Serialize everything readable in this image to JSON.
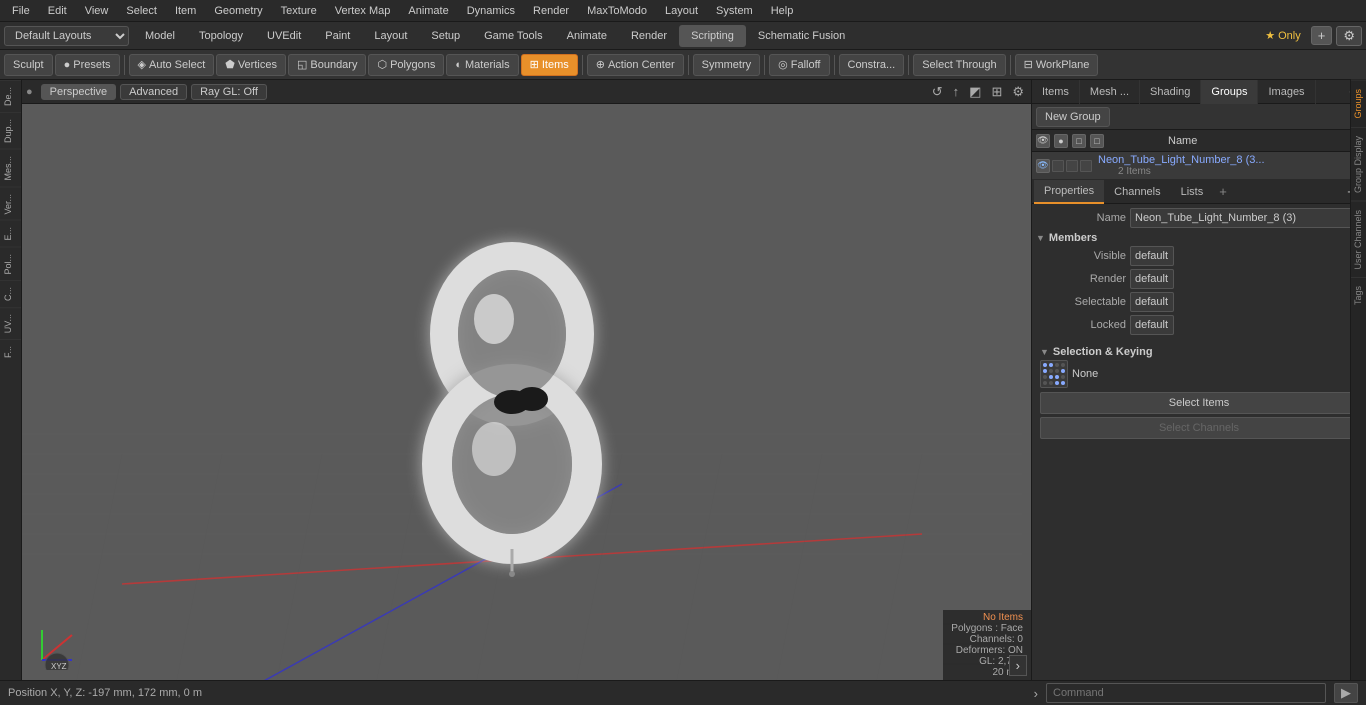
{
  "menubar": {
    "items": [
      "File",
      "Edit",
      "View",
      "Select",
      "Item",
      "Geometry",
      "Texture",
      "Vertex Map",
      "Animate",
      "Dynamics",
      "Render",
      "MaxToModo",
      "Layout",
      "System",
      "Help"
    ]
  },
  "layout_bar": {
    "selector": "Default Layouts",
    "tabs": [
      "Model",
      "Topology",
      "UVEdit",
      "Paint",
      "Layout",
      "Setup",
      "Game Tools",
      "Animate",
      "Render",
      "Scripting",
      "Schematic Fusion"
    ],
    "add_btn": "+",
    "star_only": "★ Only",
    "gear_btn": "⚙"
  },
  "toolbar": {
    "sculpt": "Sculpt",
    "presets": "Presets",
    "auto_select": "Auto Select",
    "vertices": "Vertices",
    "boundary": "Boundary",
    "polygons": "Polygons",
    "materials": "Materials",
    "items": "Items",
    "action_center": "Action Center",
    "symmetry": "Symmetry",
    "falloff": "Falloff",
    "constraints": "Constra...",
    "select_through": "Select Through",
    "workplane": "WorkPlane"
  },
  "viewport": {
    "tabs": [
      "Perspective",
      "Advanced",
      "Ray GL: Off"
    ],
    "header_icons": [
      "↺",
      "↑",
      "◩",
      "⊞",
      "⚙"
    ]
  },
  "left_sidebar": {
    "tabs": [
      "De...",
      "Dup...",
      "Mes...",
      "Ver...",
      "E...",
      "Pol...",
      "C...",
      "UV...",
      "F..."
    ]
  },
  "right_panel": {
    "top_tabs": [
      "Items",
      "Mesh ...",
      "Shading",
      "Groups",
      "Images"
    ],
    "groups_toolbar": {
      "new_group": "New Group"
    },
    "list_header": {
      "name_col": "Name"
    },
    "group_item": {
      "name": "Neon_Tube_Light_Number_8 (3...",
      "full_name": "Neon_Tube_Light_Number_8 (3)",
      "count": "2 Items"
    }
  },
  "properties": {
    "tabs": [
      "Properties",
      "Channels",
      "Lists"
    ],
    "add_tab": "+",
    "name_label": "Name",
    "name_value": "Neon_Tube_Light_Number_8 (3)",
    "members_section": "Members",
    "fields": [
      {
        "label": "Visible",
        "value": "default"
      },
      {
        "label": "Render",
        "value": "default"
      },
      {
        "label": "Selectable",
        "value": "default"
      },
      {
        "label": "Locked",
        "value": "default"
      }
    ],
    "selection_keying": {
      "title": "Selection & Keying",
      "icon_label": "None",
      "select_items_btn": "Select Items",
      "select_channels_btn": "Select Channels"
    }
  },
  "status_bar": {
    "position": "Position X, Y, Z:  -197 mm, 172 mm, 0 m",
    "command_placeholder": "Command"
  },
  "viewport_status": {
    "no_items": "No Items",
    "polygons": "Polygons : Face",
    "channels": "Channels: 0",
    "deformers": "Deformers: ON",
    "gl": "GL: 2,784",
    "distance": "20 mm"
  },
  "edge_tabs": [
    "Groups",
    "Group Display",
    "User Channels",
    "Tags"
  ]
}
